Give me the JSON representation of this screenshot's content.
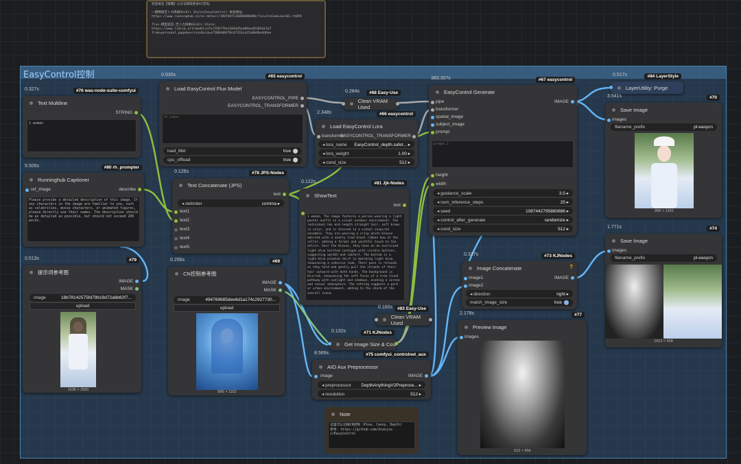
{
  "top_note": {
    "text": "欢迎关注【银鹰】公众号获取更多AI咨询。\n\n一键畅爽吉卜力风格Ghibli Style(EasyControl) 体验地址：\nhttps://www.runninghub.cn/ai-detail/1907697126896906090/?inviteCode=kol01-rh059\n\nflux-模型适应-吉卜力风格Ghibli Style:\nhttps://www.liblib.art/modelinfo/558779e1284d45aa89aed5365d13a7\nfrom=personal_page&versionUuid=e72884d8370c4721bca31a8b4ba4d6ae"
  },
  "group": {
    "title": "EasyControl控制"
  },
  "nodes": {
    "text_multiline": {
      "time": "0.327s",
      "badge": "#76 was-node-suite-comfyui",
      "title": "Text Multiline",
      "out": "STRING",
      "text": "1 woman"
    },
    "runninghub": {
      "time": "5.505s",
      "badge": "#80 rh_prompter",
      "title": "Runninghub Captioner",
      "in": "ref_image",
      "out": "describe",
      "text": "Please provide a detailed description of this image. If any characters in the image are familiar to you, such as celebrities, movie characters, or animated figures, please directly use their names. The description should be as detailed as possible, but should not exceed 200 words."
    },
    "ref_img": {
      "time": "0.513s",
      "badge": "#79",
      "title": "提示词参考图",
      "out1": "IMAGE",
      "out2": "MASK",
      "image_label": "image",
      "image_val": "18b78142575fd79b18d72a6b62f7...",
      "upload": "upload",
      "caption": "1536 × 2560"
    },
    "load_easy": {
      "time": "0.930s",
      "badge": "#65 easycontrol",
      "title": "Load EasyControl Flux Model",
      "out1": "EASYCONTROL_PIPE",
      "out2": "EASYCONTROL_TRANSFORMER",
      "text": "hf_token",
      "w1": "load_8bit",
      "w1v": "true",
      "w2": "cpu_offload",
      "w2v": "true"
    },
    "concat": {
      "time": "0.126s",
      "badge": "#78 JPS-Nodes",
      "title": "Text Concatenate (JPS)",
      "out": "text",
      "delim_label": "delimiter",
      "delim_val": "comma",
      "inputs": [
        "text1",
        "text2",
        "text3",
        "text4",
        "text5"
      ]
    },
    "cn_ref": {
      "time": "0.256s",
      "badge": "#69",
      "title": "CN控制参考图",
      "out1": "IMAGE",
      "out2": "MASK",
      "image_label": "image",
      "image_val": "494769685dee6d1a174c2927730...",
      "upload": "upload",
      "caption": "896 × 1152"
    },
    "vram1": {
      "time": "0.284s",
      "badge": "#68 Easy-Use",
      "title": "Clean VRAM Used"
    },
    "lora": {
      "time": "2.348s",
      "badge": "#66 easycontrol",
      "title": "Load EasyControl Lora",
      "in": "transformer",
      "out": "EASYCONTROL_TRANSFORMER",
      "w1": "lora_name",
      "w1v": "EasyControl_depth.safet...",
      "w2": "lora_weight",
      "w2v": "1.00",
      "w3": "cond_size",
      "w3v": "512"
    },
    "showtext": {
      "time": "0.122s",
      "badge": "#81 Jjk-Nodes",
      "title": "ShowText",
      "out": "text",
      "text": "1 woman, The image features a person wearing a light pastel outfit in a visual outdoor environment. The individual has mid-length straight hair, soft brown in color, and is dressed in a school-inspired ensemble. They are wearing a crisp white blouse adorned with a neatly tied black ribbon bow at the collar, adding a formal and youthful touch to the attire. Over the blouse, they have on an oversized light blue knitted cardigan with visible buttons, suggesting warmth and comfort. The bottom is a light-blue pleated skirt in matching light blue, showcasing a cohesive look. Their pose is relaxed, as they hold and gently pull the strands of their hair outward with both hands. The background is blurred, showcasing the soft focus of a tree-lined pathway with sunlight and shadows, evoking a serene and casual atmosphere. The setting suggests a park or urban environment, adding to the charm of the overall scene."
    },
    "vram2": {
      "time": "0.160s",
      "badge": "#83 Easy-Use",
      "title": "Clean VRAM Used"
    },
    "getsize": {
      "time": "0.132s",
      "badge": "#71 KJNodes",
      "title": "Get Image Size & Cou"
    },
    "aio": {
      "time": "8.569s",
      "badge": "#75 comfyui_controlnet_aux",
      "title": "AIO Aux Preprocessor",
      "in": "image",
      "out": "IMAGE",
      "w1": "preprocessor",
      "w1v": "DepthAnythingV2Preproce...",
      "w2": "resolution",
      "w2v": "512"
    },
    "note": {
      "title": "Note",
      "text": "这是可以切换CN控制 (Pose, Canny, Depth)\n参考: https://github.com/Xiaojiu-z/EasyControl"
    },
    "generate": {
      "time": "383.307s",
      "badge": "#67 easycontrol",
      "title": "EasyControl Generate",
      "inputs": [
        "pipe",
        "transformer",
        "spatial_image",
        "subject_image",
        "prompt"
      ],
      "out": "IMAGE",
      "prompt_ph": "prompt_2",
      "inputs2": [
        "height",
        "width"
      ],
      "widgets": [
        [
          "guidance_scale",
          "3.5"
        ],
        [
          "num_inference_steps",
          "25"
        ],
        [
          "seed",
          "1087442795880886"
        ],
        [
          "control_after_generate",
          "randomize"
        ],
        [
          "cond_size",
          "512"
        ]
      ]
    },
    "imgconcat": {
      "time": "0.327s",
      "badge": "#73 KJNodes",
      "title": "Image Concatenate",
      "in1": "image1",
      "in2": "image2",
      "out": "IMAGE",
      "w1": "direction",
      "w1v": "right",
      "w2": "match_image_size",
      "w2v": "true",
      "help": "?"
    },
    "preview": {
      "time": "2.178s",
      "badge": "#77",
      "title": "Preview Image",
      "in": "images",
      "caption": "512 × 656"
    },
    "layerutil": {
      "time": "0.517s",
      "badge": "#84 LayerStyle",
      "title": "LayerUtility: Purge"
    },
    "save1": {
      "time": "3.541s",
      "badge": "#70",
      "title": "Save Image",
      "in": "images",
      "w1": "filename_prefix",
      "w1v": "pl-easycn",
      "caption": "896 × 1152"
    },
    "save2": {
      "time": "1.771s",
      "badge": "#74",
      "title": "Save Image",
      "in": "images",
      "w1": "filename_prefix",
      "w1v": "pl-easycn",
      "caption": "1623 × 658"
    }
  },
  "colors": {
    "wire_string": "#8fbf3f",
    "wire_image": "#64b5f6",
    "wire_mask": "#81c784",
    "wire_pipe": "#aaaaaa"
  }
}
